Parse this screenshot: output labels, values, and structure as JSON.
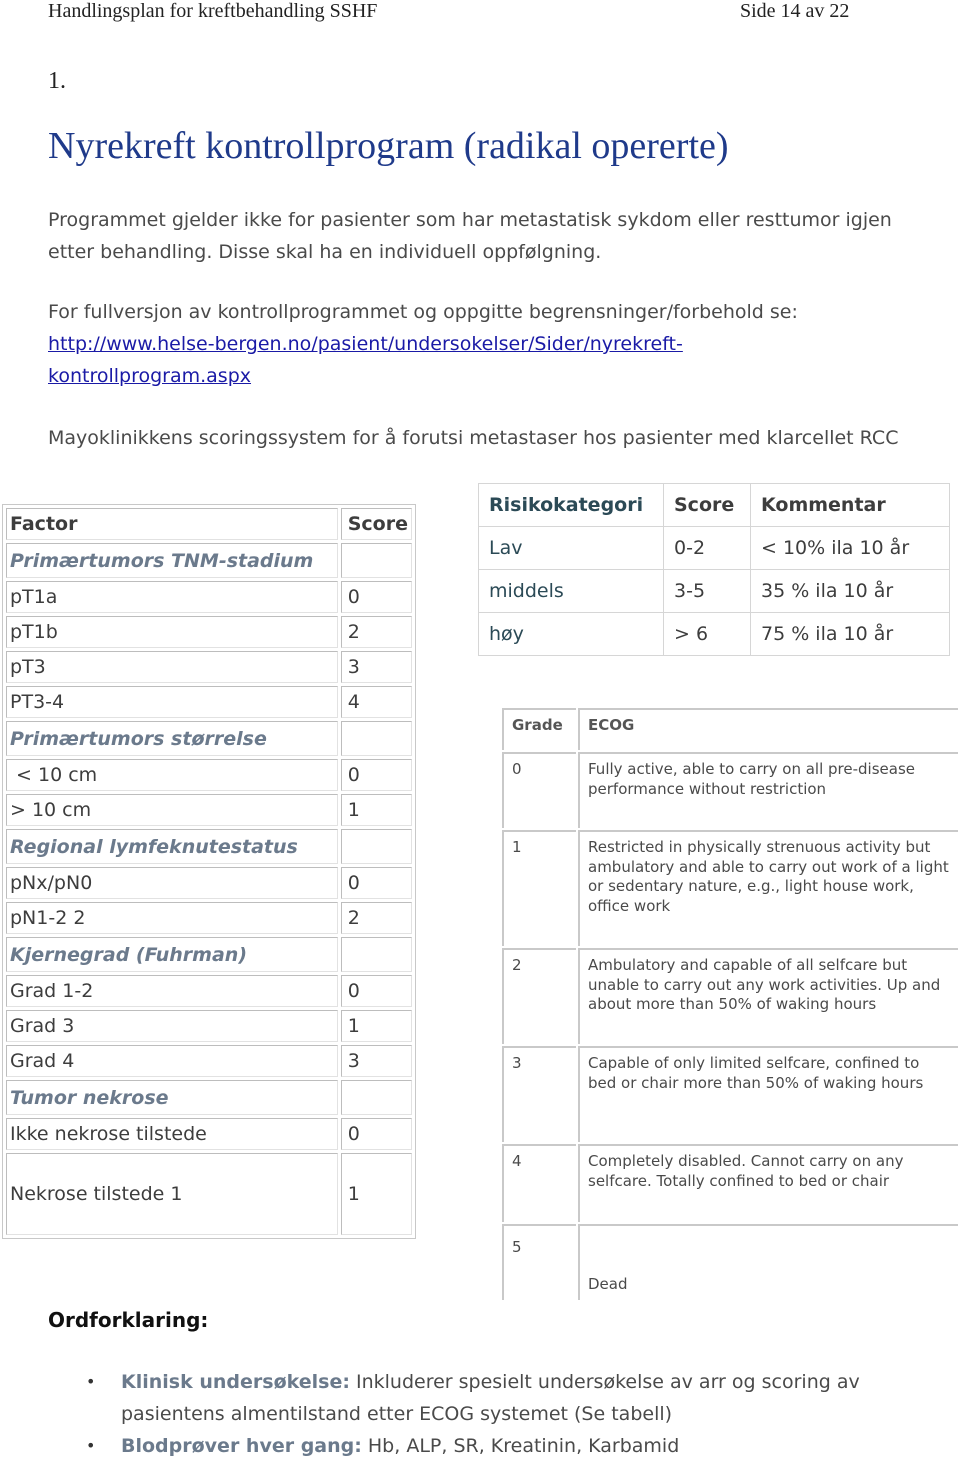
{
  "header": {
    "document_title": "Handlingsplan for kreftbehandling SSHF",
    "page_indicator": "Side 14 av 22"
  },
  "section": {
    "number": "1.",
    "title": "Nyrekreft kontrollprogram (radikal opererte)"
  },
  "intro": {
    "text": "Programmet gjelder ikke for pasienter som har metastatisk sykdom eller resttumor igjen etter behandling. Disse skal ha en individuell oppfølgning."
  },
  "reference": {
    "text": "For fullversjon av kontrollprogrammet og oppgitte begrensninger/forbehold se:",
    "link_line1": "http://www.helse-bergen.no/pasient/undersokelser/Sider/nyrekreft-",
    "link_line2": "kontrollprogram.aspx"
  },
  "mayo_caption": "Mayoklinikkens scoringssystem for å forutsi metastaser hos pasienter med klarcellet RCC",
  "factor_table": {
    "headers": {
      "factor": "Factor",
      "score": "Score"
    },
    "rows": [
      {
        "label": "Primærtumors TNM-stadium",
        "score": "",
        "category": true
      },
      {
        "label": "pT1a",
        "score": "0"
      },
      {
        "label": "pT1b",
        "score": "2"
      },
      {
        "label": "pT3",
        "score": "3"
      },
      {
        "label": "PT3-4",
        "score": "4"
      },
      {
        "label": "Primærtumors størrelse",
        "score": "",
        "category": true
      },
      {
        "label": " < 10 cm",
        "score": "0"
      },
      {
        "label": "> 10 cm",
        "score": "1"
      },
      {
        "label": "Regional lymfeknutestatus",
        "score": "",
        "category": true
      },
      {
        "label": "pNx/pN0",
        "score": "0"
      },
      {
        "label": "pN1-2 2",
        "score": "2"
      },
      {
        "label": "Kjernegrad (Fuhrman)",
        "score": "",
        "category": true
      },
      {
        "label": "Grad 1-2",
        "score": "0"
      },
      {
        "label": "Grad 3",
        "score": "1"
      },
      {
        "label": "Grad 4",
        "score": "3"
      },
      {
        "label": "Tumor nekrose",
        "score": "",
        "category": true
      },
      {
        "label": "Ikke nekrose tilstede",
        "score": "0"
      },
      {
        "label": "Nekrose tilstede 1",
        "score": "1"
      }
    ]
  },
  "risk_table": {
    "headers": {
      "category": "Risikokategori",
      "score": "Score",
      "comment": "Kommentar"
    },
    "rows": [
      {
        "category": "Lav",
        "score": "0-2",
        "comment": "< 10% ila 10 år"
      },
      {
        "category": "middels",
        "score": "3-5",
        "comment": "35 % ila 10 år"
      },
      {
        "category": "høy",
        "score": "> 6",
        "comment": "75 % ila 10 år"
      }
    ]
  },
  "ecog_table": {
    "headers": {
      "grade": "Grade",
      "ecog": "ECOG"
    },
    "rows": [
      {
        "grade": "0",
        "description": "Fully active, able to carry on all pre-disease performance without restriction"
      },
      {
        "grade": "1",
        "description": "Restricted in physically strenuous activity but ambulatory and able to carry out work of a light or sedentary nature, e.g., light house work, office work"
      },
      {
        "grade": "2",
        "description": "Ambulatory and capable of all selfcare but unable to carry out any work activities. Up and about more than 50% of waking hours"
      },
      {
        "grade": "3",
        "description": "Capable of only limited selfcare, confined to bed or chair more than 50% of waking hours"
      },
      {
        "grade": "4",
        "description": "Completely disabled. Cannot carry on any selfcare. Totally confined to bed or chair"
      },
      {
        "grade": "5",
        "description": "Dead"
      }
    ]
  },
  "glossary": {
    "heading": "Ordforklaring:",
    "items": [
      {
        "term": "Klinisk undersøkelse:",
        "definition": " Inkluderer spesielt undersøkelse av arr og scoring av pasientens almentilstand etter ECOG systemet (Se tabell)"
      },
      {
        "term": "Blodprøver hver gang:",
        "definition": " Hb, ALP, SR, Kreatinin, Karbamid"
      }
    ],
    "bullet_icon": "•"
  },
  "colors": {
    "title_blue": "#1f3a8a",
    "link_blue": "#1a1aa6",
    "category_gray_blue": "#6b7a8c",
    "body_text": "#4a4a4a"
  }
}
